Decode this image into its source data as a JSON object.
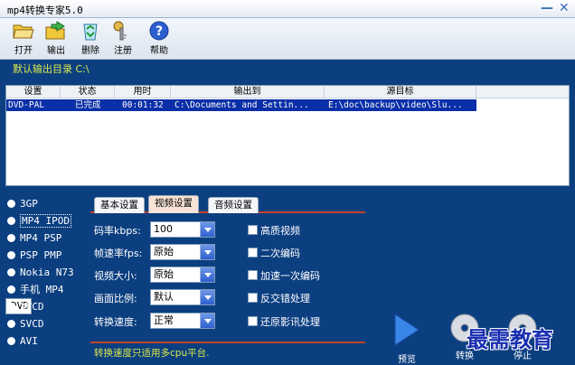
{
  "window": {
    "title": "mp4转换专家5.0",
    "minimize": "—",
    "close": "✕"
  },
  "toolbar": {
    "open": {
      "label": "打开",
      "icon": "folder-open-icon"
    },
    "output": {
      "label": "输出",
      "icon": "folder-export-icon"
    },
    "delete": {
      "label": "删除",
      "icon": "recycle-bin-icon"
    },
    "register": {
      "label": "注册",
      "icon": "key-icon"
    },
    "help": {
      "label": "帮助",
      "icon": "help-icon"
    }
  },
  "output_dir": {
    "label": "默认输出目录 C:\\"
  },
  "list": {
    "columns": [
      "设置",
      "状态",
      "用时",
      "输出到",
      "源目标"
    ],
    "rows": [
      {
        "setting": "DVD-PAL",
        "status": "已完成",
        "time": "00:01:32",
        "output": "C:\\Documents and Settin...",
        "source": "E:\\doc\\backup\\video\\Slu..."
      }
    ]
  },
  "formats": {
    "items": [
      "3GP",
      "MP4 IPOD",
      "MP4 PSP",
      "PSP PMP",
      "Nokia N73",
      "手机 MP4",
      "DVD",
      "XVCD",
      "SVCD",
      "AVI"
    ],
    "selected": "DVD"
  },
  "tabs": {
    "basic": "基本设置",
    "video": "视频设置",
    "audio": "音频设置",
    "active": "视频设置"
  },
  "video": {
    "bitrate": {
      "label": "码率kbps:",
      "value": "100"
    },
    "fps": {
      "label": "帧速率fps:",
      "value": "原始"
    },
    "size": {
      "label": "视频大小:",
      "value": "原始"
    },
    "aspect": {
      "label": "画面比例:",
      "value": "默认"
    },
    "speed": {
      "label": "转换速度:",
      "value": "正常"
    }
  },
  "options": {
    "hq": "高质视频",
    "twopass": "二次编码",
    "fastpass": "加速一次编码",
    "deinterlace": "反交错处理",
    "restore": "还原影讯处理"
  },
  "hint": "转换速度只适用多cpu平台.",
  "actions": {
    "preview": "预览",
    "convert": "转换",
    "stop": "停止"
  },
  "watermark": "最需教育",
  "colors": {
    "background": "#0c3f80",
    "highlight": "#0a2fa8",
    "accent": "#c0432b",
    "hint": "#d9e94a"
  }
}
